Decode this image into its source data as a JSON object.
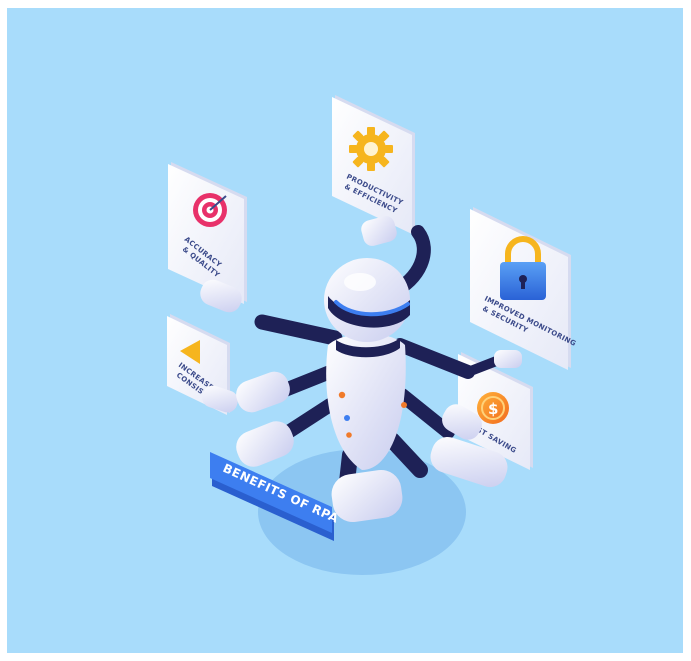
{
  "colors": {
    "background": "#a8dcfb",
    "robot_body": "#eef0fb",
    "robot_dark": "#1e2156",
    "banner": "#3d7ef0",
    "shadow": "#84c1f0"
  },
  "banner": {
    "label": "BENEFITS OF RPA"
  },
  "cards": {
    "accuracy": {
      "line1": "ACCURACY",
      "line2": "& QUALITY",
      "icon": "target-icon"
    },
    "productivity": {
      "line1": "PRODUCTIVITY",
      "line2": "& EFFICIENCY",
      "icon": "gear-icon"
    },
    "security": {
      "line1": "IMPROVED MONITORING",
      "line2": "& SECURITY",
      "icon": "lock-icon"
    },
    "speed": {
      "line1": "INCREASED",
      "line2": "CONSISTENCY",
      "icon": "play-triangle-icon"
    },
    "cost": {
      "line1": "COST SAVING",
      "icon": "dollar-coin-icon"
    }
  }
}
